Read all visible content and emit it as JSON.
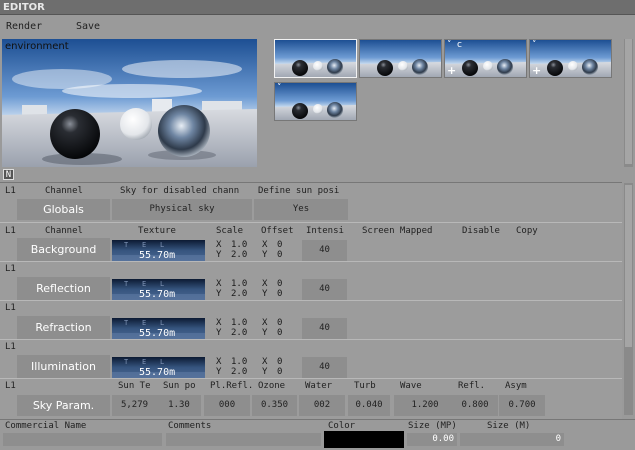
{
  "window": {
    "title": "EDITOR"
  },
  "menu": {
    "render": "Render",
    "save": "Save"
  },
  "preview": {
    "label": "environment"
  },
  "thumbnails": [
    {
      "label": "",
      "plus": false,
      "selected": true
    },
    {
      "label": "",
      "plus": false,
      "selected": false
    },
    {
      "label": "c",
      "plus": true,
      "selected": false
    },
    {
      "label": "",
      "plus": true,
      "selected": false
    },
    {
      "label": "",
      "plus": false,
      "selected": false
    }
  ],
  "n_button": "N",
  "globals": {
    "layer": "L1",
    "headers": {
      "channel": "Channel",
      "sky_disabled": "Sky for disabled chann",
      "define_sun": "Define sun posi"
    },
    "name": "Globals",
    "sky_disabled_value": "Physical sky",
    "define_sun_value": "Yes"
  },
  "channels_header": {
    "layer": "L1",
    "channel": "Channel",
    "texture": "Texture",
    "scale": "Scale",
    "offset": "Offset",
    "intensity": "Intensi",
    "screen_mapped": "Screen Mapped",
    "disable": "Disable",
    "copy": "Copy"
  },
  "channels": [
    {
      "layer": "",
      "name": "Background",
      "texture": "55.70m",
      "tex_letters": [
        "T",
        "E",
        "L"
      ],
      "scale_x": "1.0",
      "scale_y": "2.0",
      "offset_x": "0",
      "offset_y": "0",
      "intensity": "40"
    },
    {
      "layer": "L1",
      "name": "Reflection",
      "texture": "55.70m",
      "tex_letters": [
        "T",
        "E",
        "L"
      ],
      "scale_x": "1.0",
      "scale_y": "2.0",
      "offset_x": "0",
      "offset_y": "0",
      "intensity": "40"
    },
    {
      "layer": "L1",
      "name": "Refraction",
      "texture": "55.70m",
      "tex_letters": [
        "T",
        "E",
        "L"
      ],
      "scale_x": "1.0",
      "scale_y": "2.0",
      "offset_x": "0",
      "offset_y": "0",
      "intensity": "40"
    },
    {
      "layer": "L1",
      "name": "Illumination",
      "texture": "55.70m",
      "tex_letters": [
        "T",
        "E",
        "L"
      ],
      "scale_x": "1.0",
      "scale_y": "2.0",
      "offset_x": "0",
      "offset_y": "0",
      "intensity": "40"
    }
  ],
  "axis_labels": {
    "x": "X",
    "y": "Y"
  },
  "sky": {
    "layer": "L1",
    "name": "Sky Param.",
    "headers": [
      "Sun Te",
      "Sun po",
      "Pl.Refl.",
      "Ozone",
      "Water",
      "Turb",
      "Wave",
      "Refl.",
      "Asym"
    ],
    "values": [
      "5,279",
      "1.30",
      "000",
      "0.350",
      "002",
      "0.040",
      "1.200",
      "0.800",
      "0.700"
    ]
  },
  "bottom": {
    "commercial_name": "Commercial Name",
    "comments": "Comments",
    "color": "Color",
    "size_mp": "Size (MP)",
    "size_m": "Size (M)",
    "size_mp_value": "0.00",
    "size_m_value": "0",
    "color_swatch": "#000000"
  }
}
